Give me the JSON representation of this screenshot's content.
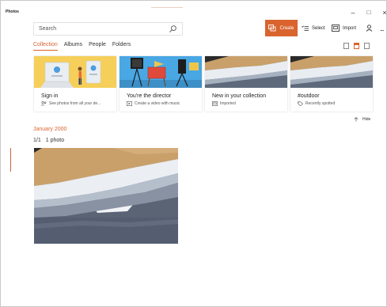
{
  "app": {
    "title": "Photos"
  },
  "window_controls": {
    "minimize": "–",
    "maximize": "□",
    "close": "×"
  },
  "search": {
    "placeholder": "Search"
  },
  "toolbar": {
    "create_label": "Create",
    "select_label": "Select",
    "import_label": "Import",
    "account_icon": "person-icon",
    "more_label": "..."
  },
  "tabs": [
    {
      "label": "Collection",
      "active": true
    },
    {
      "label": "Albums",
      "active": false
    },
    {
      "label": "People",
      "active": false
    },
    {
      "label": "Folders",
      "active": false
    }
  ],
  "cards": [
    {
      "title": "Sign in",
      "subtitle": "See photos from all your de...",
      "icon": "people-icon"
    },
    {
      "title": "You're the director",
      "subtitle": "Create a video with music",
      "icon": "video-icon"
    },
    {
      "title": "New in your collection",
      "subtitle": "Imported",
      "icon": "import-icon"
    },
    {
      "title": "#outdoor",
      "subtitle": "Recently spotted",
      "icon": "tag-icon"
    }
  ],
  "hide_label": "Hide",
  "group": {
    "date": "January 2000",
    "selection_fraction": "1/1",
    "count_label": "1 photo"
  },
  "colors": {
    "accent": "#d9642e",
    "sand": "#c9a06a",
    "sea": "#5a6475",
    "foam": "#ebeef2"
  }
}
